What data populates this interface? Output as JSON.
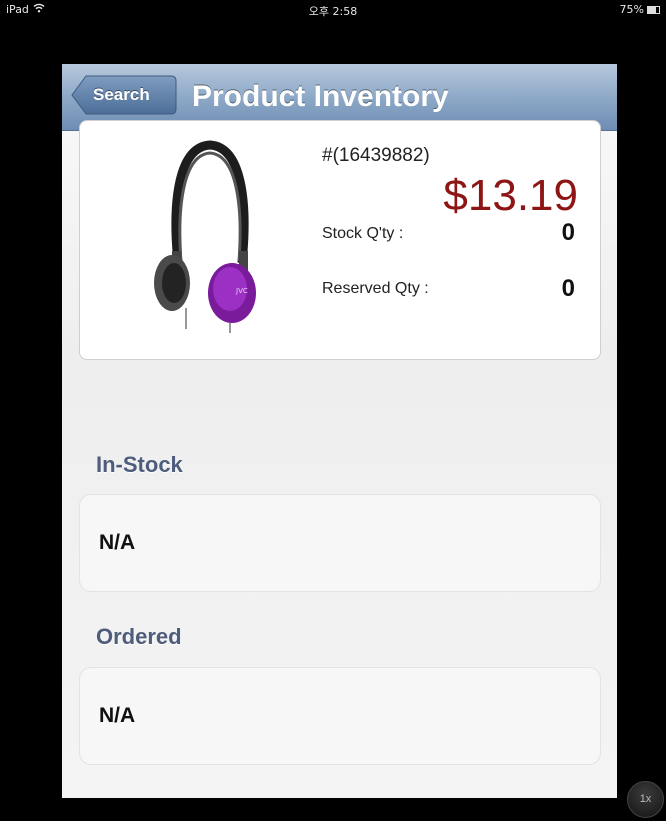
{
  "status_bar": {
    "device": "iPad",
    "time": "오후 2:58",
    "battery": "75%",
    "battery_level": 0.75
  },
  "nav": {
    "back_label": "Search",
    "title": "Product Inventory"
  },
  "product": {
    "sku": "#(16439882)",
    "price": "$13.19",
    "stock_label": "Stock Q'ty :",
    "stock_value": "0",
    "reserved_label": "Reserved Qty :",
    "reserved_value": "0"
  },
  "sections": [
    {
      "title": "In-Stock",
      "value": "N/A"
    },
    {
      "title": "Ordered",
      "value": "N/A"
    }
  ],
  "zoom": {
    "label": "1x"
  },
  "colors": {
    "price": "#8e1515",
    "nav_bar": "#8ea9c8",
    "section_title": "#4e5d7b"
  }
}
